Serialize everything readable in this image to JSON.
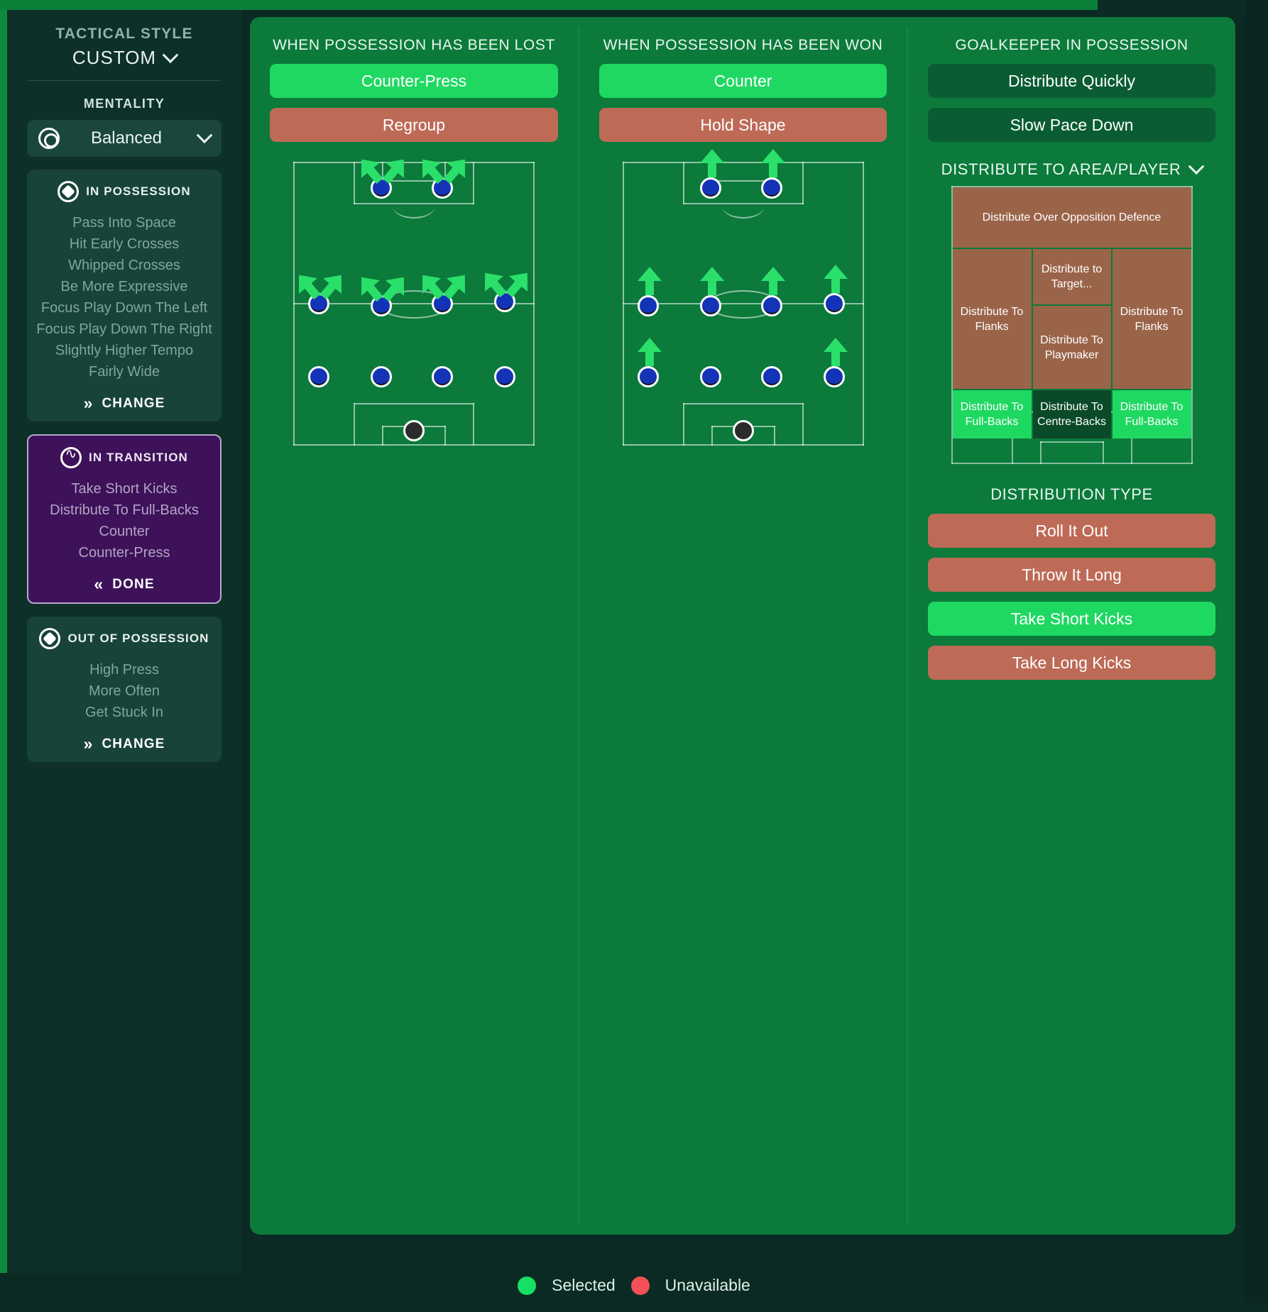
{
  "sidebar": {
    "tactical_style_label": "TACTICAL STYLE",
    "tactical_style_value": "CUSTOM",
    "mentality_label": "MENTALITY",
    "mentality_value": "Balanced",
    "in_possession": {
      "title": "IN POSSESSION",
      "items": [
        "Pass Into Space",
        "Hit Early Crosses",
        "Whipped Crosses",
        "Be More Expressive",
        "Focus Play Down The Left",
        "Focus Play Down The Right",
        "Slightly Higher Tempo",
        "Fairly Wide"
      ],
      "action": "CHANGE"
    },
    "in_transition": {
      "title": "IN TRANSITION",
      "items": [
        "Take Short Kicks",
        "Distribute To Full-Backs",
        "Counter",
        "Counter-Press"
      ],
      "action": "DONE"
    },
    "out_of_possession": {
      "title": "OUT OF POSSESSION",
      "items": [
        "High Press",
        "More Often",
        "Get Stuck In"
      ],
      "action": "CHANGE"
    }
  },
  "columns": {
    "lost": {
      "title": "WHEN POSSESSION HAS BEEN LOST",
      "buttons": [
        {
          "label": "Counter-Press",
          "state": "selected"
        },
        {
          "label": "Regroup",
          "state": "unavailable"
        }
      ]
    },
    "won": {
      "title": "WHEN POSSESSION HAS BEEN WON",
      "buttons": [
        {
          "label": "Counter",
          "state": "selected"
        },
        {
          "label": "Hold Shape",
          "state": "unavailable"
        }
      ]
    },
    "goalkeeper": {
      "title": "GOALKEEPER IN POSSESSION",
      "buttons": [
        {
          "label": "Distribute Quickly",
          "state": "off"
        },
        {
          "label": "Slow Pace Down",
          "state": "off"
        }
      ],
      "dist_area_title": "DISTRIBUTE TO AREA/PLAYER",
      "dist_cells": [
        {
          "label": "Distribute Over Opposition Defence",
          "state": "unavailable"
        },
        {
          "label": "Distribute to Target...",
          "state": "unavailable"
        },
        {
          "label": "Distribute To Flanks",
          "state": "unavailable"
        },
        {
          "label": "Distribute To Flanks",
          "state": "unavailable"
        },
        {
          "label": "Distribute To Playmaker",
          "state": "unavailable"
        },
        {
          "label": "Distribute To Full-Backs",
          "state": "selected"
        },
        {
          "label": "Distribute To Centre-Backs",
          "state": "off"
        },
        {
          "label": "Distribute To Full-Backs",
          "state": "selected"
        }
      ],
      "dist_type_title": "DISTRIBUTION TYPE",
      "dist_type_buttons": [
        {
          "label": "Roll It Out",
          "state": "unavailable"
        },
        {
          "label": "Throw It Long",
          "state": "unavailable"
        },
        {
          "label": "Take Short Kicks",
          "state": "selected"
        },
        {
          "label": "Take Long Kicks",
          "state": "unavailable"
        }
      ]
    }
  },
  "legend": {
    "selected_label": "Selected",
    "unavailable_label": "Unavailable",
    "selected_color": "#15e065",
    "unavailable_color": "#f4505a"
  }
}
